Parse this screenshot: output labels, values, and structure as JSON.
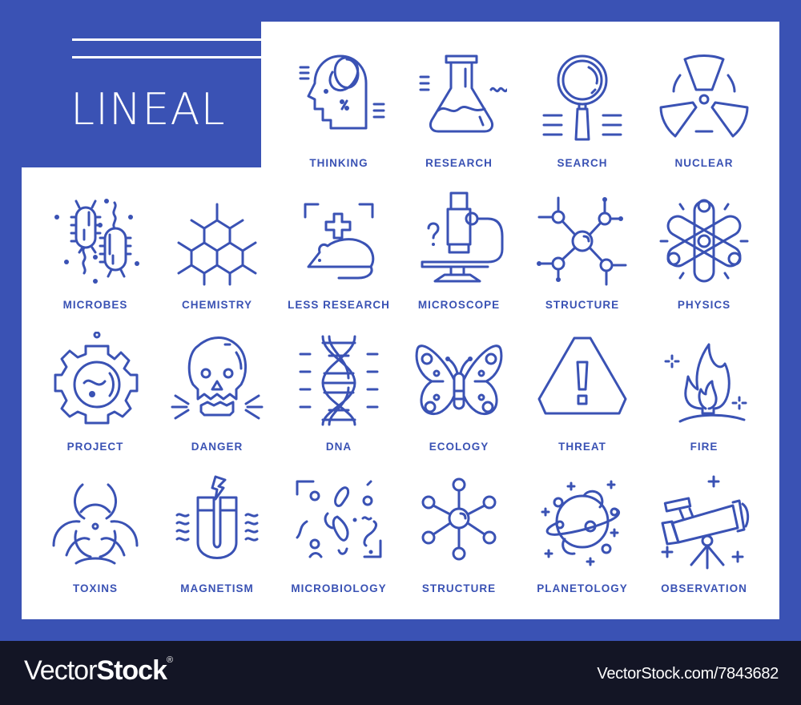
{
  "header": {
    "title": "LINEAL"
  },
  "colors": {
    "accent": "#3a52b4",
    "panel": "#ffffff",
    "footer": "#131525"
  },
  "icons": [
    {
      "label": "THINKING",
      "icon": "head-thinking-icon"
    },
    {
      "label": "RESEARCH",
      "icon": "flask-icon"
    },
    {
      "label": "SEARCH",
      "icon": "magnifier-icon"
    },
    {
      "label": "NUCLEAR",
      "icon": "radiation-icon"
    },
    {
      "label": "MICROBES",
      "icon": "bacteria-icon"
    },
    {
      "label": "CHEMISTRY",
      "icon": "hexagon-molecule-icon"
    },
    {
      "label": "LESS RESEARCH",
      "icon": "lab-mouse-icon"
    },
    {
      "label": "MICROSCOPE",
      "icon": "microscope-icon"
    },
    {
      "label": "STRUCTURE",
      "icon": "molecule-network-icon"
    },
    {
      "label": "PHYSICS",
      "icon": "atom-icon"
    },
    {
      "label": "PROJECT",
      "icon": "gear-flask-icon"
    },
    {
      "label": "DANGER",
      "icon": "skull-icon"
    },
    {
      "label": "DNA",
      "icon": "dna-helix-icon"
    },
    {
      "label": "ECOLOGY",
      "icon": "butterfly-icon"
    },
    {
      "label": "THREAT",
      "icon": "warning-triangle-icon"
    },
    {
      "label": "FIRE",
      "icon": "fire-icon"
    },
    {
      "label": "TOXINS",
      "icon": "biohazard-icon"
    },
    {
      "label": "MAGNETISM",
      "icon": "magnet-icon"
    },
    {
      "label": "MICROBIOLOGY",
      "icon": "microorganisms-icon"
    },
    {
      "label": "STRUCTURE",
      "icon": "molecule-star-icon"
    },
    {
      "label": "PLANETOLOGY",
      "icon": "planet-icon"
    },
    {
      "label": "OBSERVATION",
      "icon": "telescope-icon"
    }
  ],
  "footer": {
    "brand_thin": "Vector",
    "brand_bold": "Stock",
    "registered": "®",
    "stock_id": "VectorStock.com/7843682"
  }
}
